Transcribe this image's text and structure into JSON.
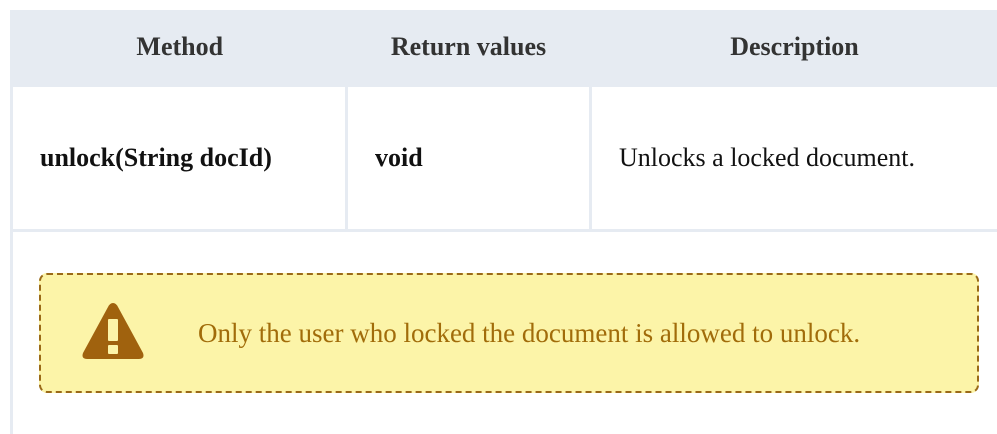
{
  "table": {
    "headers": {
      "method": "Method",
      "return_values": "Return values",
      "description": "Description"
    },
    "rows": [
      {
        "method": "unlock(String docId)",
        "return_values": "void",
        "description": "Unlocks a locked document."
      }
    ]
  },
  "note": {
    "icon": "warning-icon",
    "text": "Only the user who locked the document is allowed to unlock.",
    "colors": {
      "background": "#fcf4a8",
      "border": "#9a6a18",
      "text": "#a16c0a",
      "icon": "#a0620e"
    }
  }
}
